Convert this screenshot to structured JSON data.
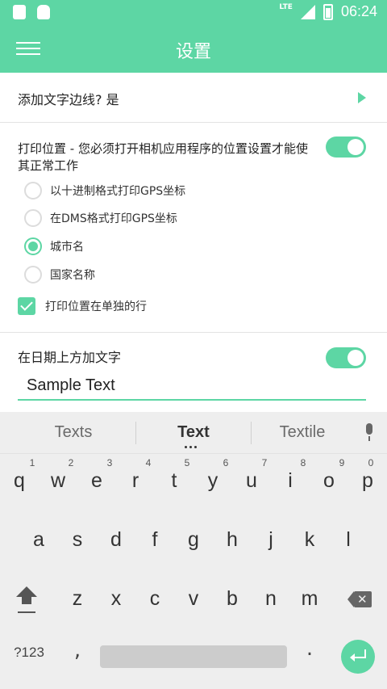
{
  "status_bar": {
    "network": "LTE",
    "time": "06:24"
  },
  "app_bar": {
    "title": "设置"
  },
  "settings": {
    "border_row": {
      "label": "添加文字边线? 是"
    },
    "location": {
      "description": "打印位置 - 您必须打开相机应用程序的位置设置才能使其正常工作",
      "toggle_on": true,
      "options": [
        {
          "label": "以十进制格式打印GPS坐标",
          "selected": false
        },
        {
          "label": "在DMS格式打印GPS坐标",
          "selected": false
        },
        {
          "label": "城市名",
          "selected": true
        },
        {
          "label": "国家名称",
          "selected": false
        }
      ],
      "separate_line": {
        "label": "打印位置在单独的行",
        "checked": true
      }
    },
    "date_text": {
      "label": "在日期上方加文字",
      "toggle_on": true,
      "input_value": "Sample Text"
    }
  },
  "keyboard": {
    "suggestions": [
      "Texts",
      "Text",
      "Textile"
    ],
    "row1": [
      {
        "key": "q",
        "hint": "1"
      },
      {
        "key": "w",
        "hint": "2"
      },
      {
        "key": "e",
        "hint": "3"
      },
      {
        "key": "r",
        "hint": "4"
      },
      {
        "key": "t",
        "hint": "5"
      },
      {
        "key": "y",
        "hint": "6"
      },
      {
        "key": "u",
        "hint": "7"
      },
      {
        "key": "i",
        "hint": "8"
      },
      {
        "key": "o",
        "hint": "9"
      },
      {
        "key": "p",
        "hint": "0"
      }
    ],
    "row2": [
      "a",
      "s",
      "d",
      "f",
      "g",
      "h",
      "j",
      "k",
      "l"
    ],
    "row3": [
      "z",
      "x",
      "c",
      "v",
      "b",
      "n",
      "m"
    ],
    "symbols_label": "?123",
    "comma": ",",
    "period": "."
  },
  "colors": {
    "accent": "#5dd6a4",
    "keyboard_bg": "#eeeeee"
  },
  "icons": [
    "menu-icon",
    "play-arrow-icon",
    "mic-icon",
    "shift-icon",
    "backspace-icon",
    "enter-icon"
  ]
}
